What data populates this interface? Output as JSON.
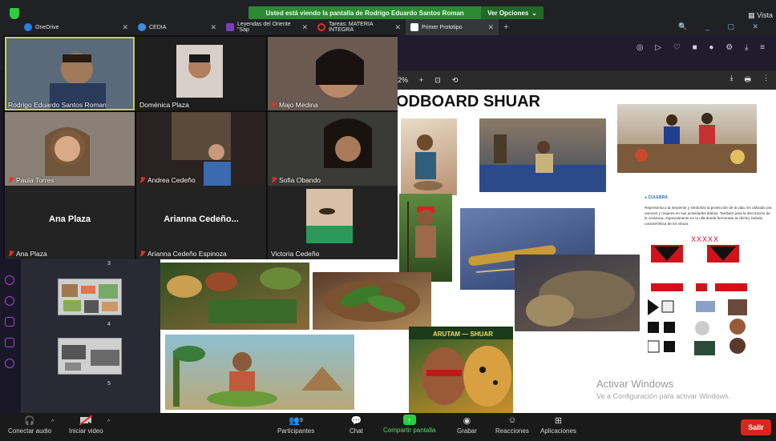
{
  "share_banner": {
    "message": "Usted está viendo la pantalla de Rodrigo Eduardo Santos Roman",
    "options_label": "Ver Opciones"
  },
  "window": {
    "vista_label": "Vista"
  },
  "browser_tabs": [
    {
      "label": "OneDrive",
      "icon_color": "#2a7de1"
    },
    {
      "label": "CEDIA",
      "icon_color": "#3b8de0"
    },
    {
      "label": "Leyendas del Oriente \"Sap",
      "icon_color": "#7b3fb7"
    },
    {
      "label": "Tareas: MATERIA INTEGRA",
      "icon_color": "#e0312d"
    },
    {
      "label": "Primer Prototipo",
      "icon_color": "#ffffff"
    }
  ],
  "doc_toolbar": {
    "zoom": "2%",
    "plus": "+"
  },
  "moodboard": {
    "title": "ODBOARD SHUAR",
    "section_heading": "● CULEBRA",
    "description": "Representa a la serpiente y simboliza la protección de la vida. Es utilizado por varones y mujeres en sus actividades diarias. También para la decoración de la cerámica, especialmente en la olla donde fermentan la chicha, bebida característica de los Shuar.",
    "pattern_text": "XXXXX",
    "poster_label": "ARUTAM — SHUAR"
  },
  "windows_activation": {
    "title": "Activar Windows",
    "subtitle": "Ve a Configuración para activar Windows."
  },
  "pages_panel": {
    "page_numbers": [
      "3",
      "4",
      "5"
    ]
  },
  "participants": [
    {
      "name": "Rodrigo Eduardo Santos Roman",
      "muted": false,
      "center_name": ""
    },
    {
      "name": "Doménica Plaza",
      "muted": false,
      "center_name": ""
    },
    {
      "name": "Majo Medina",
      "muted": true,
      "center_name": ""
    },
    {
      "name": "Paula Torres",
      "muted": true,
      "center_name": ""
    },
    {
      "name": "Andrea Cedeño",
      "muted": true,
      "center_name": ""
    },
    {
      "name": "Sofia Obando",
      "muted": true,
      "center_name": ""
    },
    {
      "name": "Ana Plaza",
      "muted": true,
      "center_name": "Ana Plaza"
    },
    {
      "name": "Arianna Cedeño Espinoza",
      "muted": true,
      "center_name": "Arianna Cedeño..."
    },
    {
      "name": "Victoria Cedeño",
      "muted": false,
      "center_name": ""
    }
  ],
  "zoom_toolbar": {
    "audio": "Conectar audio",
    "video": "Iniciar video",
    "participants": "Participantes",
    "participants_count": "9",
    "chat": "Chat",
    "share": "Compartir pantalla",
    "record": "Grabar",
    "reactions": "Reacciones",
    "apps": "Aplicaciones",
    "leave": "Salir"
  },
  "colors": {
    "share_green": "#2ecc40",
    "leave_red": "#d9261c",
    "highlight": "#c9d92c"
  }
}
